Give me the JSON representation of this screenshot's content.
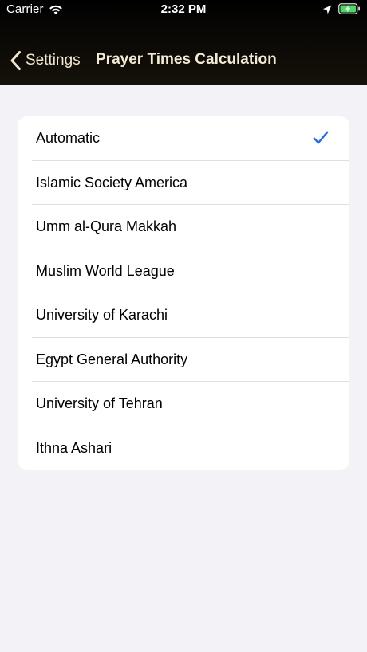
{
  "status_bar": {
    "carrier": "Carrier",
    "time": "2:32 PM",
    "icons": [
      "wifi-icon",
      "location-icon",
      "battery-charging-icon"
    ]
  },
  "nav": {
    "back_label": "Settings",
    "title": "Prayer Times Calculation"
  },
  "methods": {
    "selected_index": 0,
    "items": [
      {
        "label": "Automatic",
        "selected": true
      },
      {
        "label": "Islamic Society America",
        "selected": false
      },
      {
        "label": "Umm al-Qura Makkah",
        "selected": false
      },
      {
        "label": "Muslim World League",
        "selected": false
      },
      {
        "label": "University of Karachi",
        "selected": false
      },
      {
        "label": "Egypt General Authority",
        "selected": false
      },
      {
        "label": "University of Tehran",
        "selected": false
      },
      {
        "label": "Ithna Ashari",
        "selected": false
      }
    ]
  },
  "colors": {
    "accent": "#1f6ff2",
    "nav_text": "#f0e6cf",
    "background": "#f2f2f7",
    "header_bg": "#0b0906",
    "battery_fill": "#4cd964"
  }
}
